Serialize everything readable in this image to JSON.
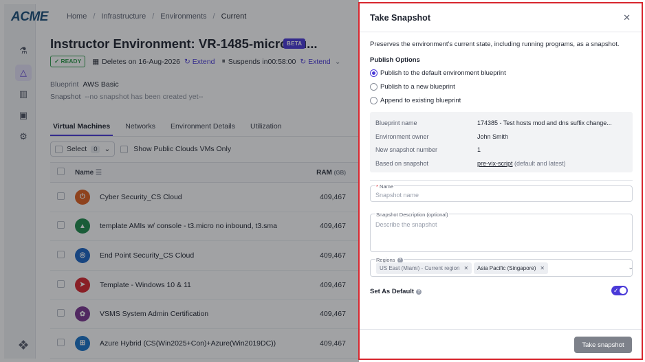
{
  "app": {
    "logo": "ACME",
    "breadcrumb": [
      "Home",
      "Infrastructure",
      "Environments",
      "Current"
    ],
    "sidebar_icons": [
      "flask-icon",
      "environments-icon",
      "reports-icon",
      "library-icon",
      "settings-icon"
    ],
    "env_title": "Instructor Environment: VR-1485-microstu...",
    "beta": "BETA",
    "status": "READY",
    "deletes_text": "Deletes on 16-Aug-2026",
    "extend": "Extend",
    "suspends_label": "Suspends in",
    "suspends_time": "00:58:00",
    "blueprint_label": "Blueprint",
    "blueprint_value": "AWS Basic",
    "snapshot_label": "Snapshot",
    "snapshot_value": "--no snapshot has been created yet--",
    "tabs": [
      "Virtual Machines",
      "Networks",
      "Environment Details",
      "Utilization"
    ],
    "select_label": "Select",
    "select_count": "0",
    "public_clouds": "Show Public Clouds VMs Only",
    "col_name": "Name",
    "col_ram": "RAM",
    "col_ram_unit": "(GB)",
    "vms": [
      {
        "name": "Cyber Security_CS Cloud",
        "ram": "409,467",
        "color": "#e0601f"
      },
      {
        "name": "template AMIs w/ console - t3.micro no inbound, t3.sma",
        "ram": "409,467",
        "color": "#1f8a4c"
      },
      {
        "name": "End Point Security_CS Cloud",
        "ram": "409,467",
        "color": "#1b64c4"
      },
      {
        "name": "Template - Windows 10 & 11",
        "ram": "409,467",
        "color": "#d7262e"
      },
      {
        "name": "VSMS System Admin Certification",
        "ram": "409,467",
        "color": "#7a3590"
      },
      {
        "name": "Azure Hybrid (CS(Win2025+Con)+Azure(Win2019DC))",
        "ram": "409,467",
        "color": "#1a73c8"
      }
    ]
  },
  "modal": {
    "title": "Take Snapshot",
    "description": "Preserves the environment's current state, including running programs, as a snapshot.",
    "publish_options_label": "Publish Options",
    "options": [
      {
        "label": "Publish to the default environment blueprint",
        "selected": true
      },
      {
        "label": "Publish to a new blueprint",
        "selected": false
      },
      {
        "label": "Append to existing blueprint",
        "selected": false
      }
    ],
    "info": {
      "blueprint_name_label": "Blueprint name",
      "blueprint_name_value": "174385 - Test hosts mod and dns suffix change...",
      "owner_label": "Environment owner",
      "owner_value": "John Smith",
      "snapnum_label": "New snapshot number",
      "snapnum_value": "1",
      "based_label": "Based on snapshot",
      "based_link": "pre-vix-script",
      "based_note": "(default and latest)"
    },
    "name_field": {
      "label": "Name",
      "required_mark": "*",
      "placeholder": "Snapshot name"
    },
    "desc_field": {
      "label": "Snapshot Description (optional)",
      "placeholder": "Describe the snapshot"
    },
    "regions": {
      "label": "Regions",
      "tags": [
        "US East (Miami) - Current region",
        "Asia Pacific (Singapore)"
      ]
    },
    "set_default_label": "Set As Default",
    "set_default_on": true,
    "submit_label": "Take snapshot"
  }
}
